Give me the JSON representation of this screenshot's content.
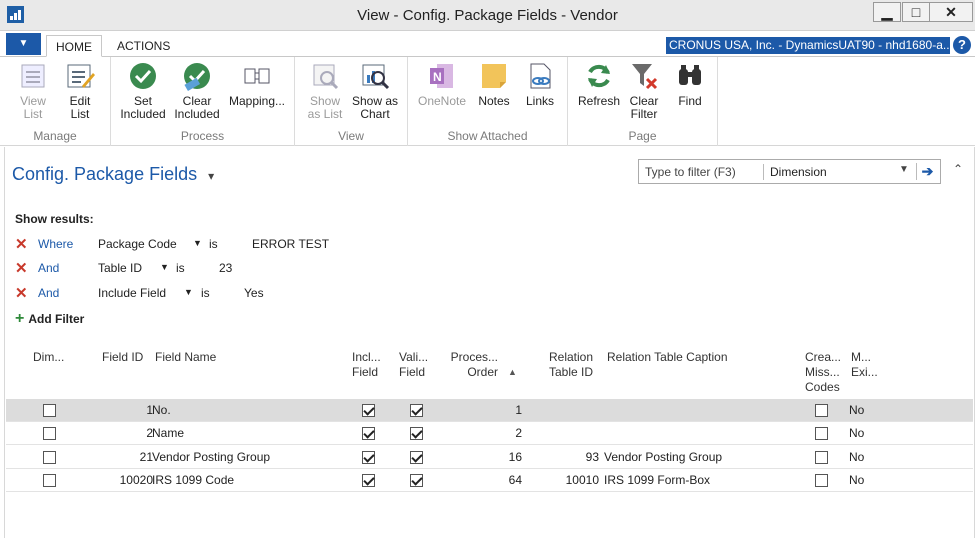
{
  "window": {
    "title": "View - Config. Package Fields - Vendor",
    "min": "▁",
    "max": "□",
    "close": "✕"
  },
  "ribbon_tabs": {
    "menu": "▼",
    "home": "HOME",
    "actions": "ACTIONS",
    "company": "CRONUS USA, Inc. - DynamicsUAT90 - nhd1680-a...",
    "help": "?"
  },
  "ribbon": {
    "manage": {
      "label": "Manage",
      "view_list": "View List",
      "edit_list": "Edit List"
    },
    "process": {
      "label": "Process",
      "set_included": "Set Included",
      "clear_included": "Clear Included",
      "mapping": "Mapping..."
    },
    "view": {
      "label": "View",
      "show_as_list": "Show as List",
      "show_as_chart": "Show as Chart"
    },
    "show_attached": {
      "label": "Show Attached",
      "onenote": "OneNote",
      "notes": "Notes",
      "links": "Links"
    },
    "page": {
      "label": "Page",
      "refresh": "Refresh",
      "clear_filter": "Clear Filter",
      "find": "Find"
    }
  },
  "page": {
    "title": "Config. Package Fields",
    "title_dd": "▾",
    "filter_placeholder": "Type to filter (F3)",
    "filter_field": "Dimension",
    "collapse": "⌃"
  },
  "filters": {
    "show_results": "Show results:",
    "rows": [
      {
        "conj": "Where",
        "field": "Package Code",
        "op": "is",
        "value": "ERROR TEST"
      },
      {
        "conj": "And",
        "field": "Table ID",
        "op": "is",
        "value": "23"
      },
      {
        "conj": "And",
        "field": "Include Field",
        "op": "is",
        "value": "Yes"
      }
    ],
    "add": "Add Filter"
  },
  "columns": {
    "dim": "Dim...",
    "field_id": "Field ID",
    "field_name": "Field Name",
    "incl": "Incl... Field",
    "vali": "Vali... Field",
    "proc": "Proces... Order",
    "sort": "▲",
    "rel_id": "Relation Table ID",
    "rel_caption": "Relation Table Caption",
    "crea": "Crea... Miss... Codes",
    "mexi": "M... Exi..."
  },
  "rows": [
    {
      "dim": false,
      "field_id": "1",
      "field_name": "No.",
      "incl": true,
      "vali": true,
      "order": "1",
      "rel_id": "",
      "rel_caption": "",
      "crea": false,
      "mexi": "No"
    },
    {
      "dim": false,
      "field_id": "2",
      "field_name": "Name",
      "incl": true,
      "vali": true,
      "order": "2",
      "rel_id": "",
      "rel_caption": "",
      "crea": false,
      "mexi": "No"
    },
    {
      "dim": false,
      "field_id": "21",
      "field_name": "Vendor Posting Group",
      "incl": true,
      "vali": true,
      "order": "16",
      "rel_id": "93",
      "rel_caption": "Vendor Posting Group",
      "crea": false,
      "mexi": "No"
    },
    {
      "dim": false,
      "field_id": "10020",
      "field_name": "IRS 1099 Code",
      "incl": true,
      "vali": true,
      "order": "64",
      "rel_id": "10010",
      "rel_caption": "IRS 1099 Form-Box",
      "crea": false,
      "mexi": "No"
    }
  ]
}
